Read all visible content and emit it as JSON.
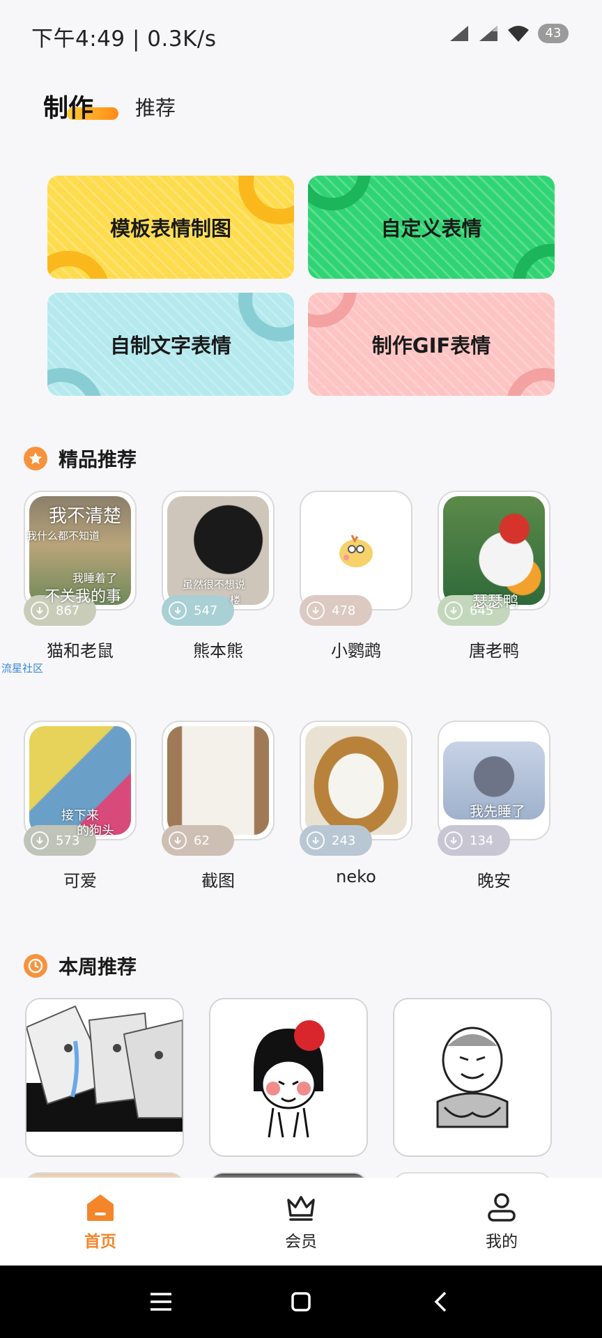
{
  "status_bar": {
    "text": "下午4:49 | 0.3K/s",
    "battery": "43"
  },
  "tabs": [
    {
      "label": "制作",
      "active": true
    },
    {
      "label": "推荐",
      "active": false
    }
  ],
  "make_buttons": [
    {
      "label": "模板表情制图",
      "color": "#fedc4d"
    },
    {
      "label": "自定义表情",
      "color": "#2fd473"
    },
    {
      "label": "自制文字表情",
      "color": "#b4e9ee"
    },
    {
      "label": "制作GIF表情",
      "color": "#fdc4c3"
    }
  ],
  "featured": {
    "title": "精品推荐",
    "packs": [
      {
        "name": "猫和老鼠",
        "downloads": "867",
        "pill_color": "#c8ccb9",
        "captions": [
          "我不清楚",
          "我什么都不知道",
          "我睡着了",
          "不关我的事"
        ]
      },
      {
        "name": "熊本熊",
        "downloads": "547",
        "pill_color": "#a9d0d4",
        "captions": [
          "虽然很不想说",
          "楼"
        ]
      },
      {
        "name": "小鹦鹉",
        "downloads": "478",
        "pill_color": "#dcc9c2",
        "captions": []
      },
      {
        "name": "唐老鸭",
        "downloads": "645",
        "pill_color": "#c2d7bb",
        "captions": [
          "瑟瑟鸭"
        ]
      },
      {
        "name": "可爱",
        "downloads": "573",
        "pill_color": "#c0c4b8",
        "captions": [
          "接下来",
          "的狗头"
        ]
      },
      {
        "name": "截图",
        "downloads": "62",
        "pill_color": "#cdbfb3",
        "captions": []
      },
      {
        "name": "neko",
        "downloads": "243",
        "pill_color": "#b9c7d4",
        "captions": []
      },
      {
        "name": "晚安",
        "downloads": "134",
        "pill_color": "#c9c6d4",
        "captions": [
          "我先睡了"
        ]
      }
    ]
  },
  "community_link": "流星社区",
  "weekly": {
    "title": "本周推荐"
  },
  "bottom_nav": [
    {
      "label": "首页",
      "active": true
    },
    {
      "label": "会员",
      "active": false
    },
    {
      "label": "我的",
      "active": false
    }
  ],
  "accent_color": "#f5852a"
}
